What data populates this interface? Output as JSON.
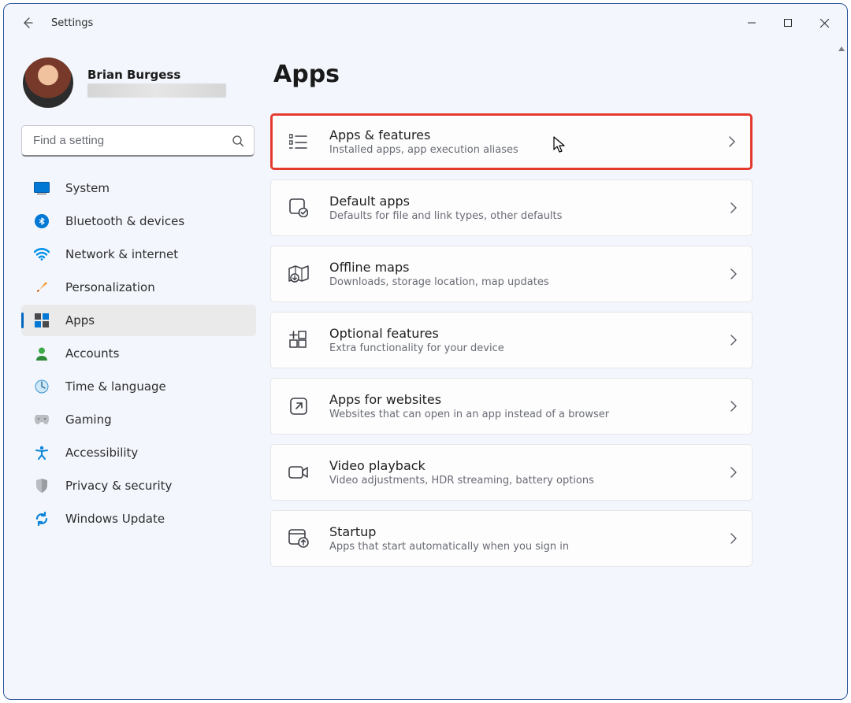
{
  "window": {
    "title": "Settings"
  },
  "profile": {
    "name": "Brian Burgess"
  },
  "search": {
    "placeholder": "Find a setting"
  },
  "nav": {
    "items": [
      {
        "id": "system",
        "label": "System"
      },
      {
        "id": "bluetooth",
        "label": "Bluetooth & devices"
      },
      {
        "id": "network",
        "label": "Network & internet"
      },
      {
        "id": "personalization",
        "label": "Personalization"
      },
      {
        "id": "apps",
        "label": "Apps"
      },
      {
        "id": "accounts",
        "label": "Accounts"
      },
      {
        "id": "time",
        "label": "Time & language"
      },
      {
        "id": "gaming",
        "label": "Gaming"
      },
      {
        "id": "accessibility",
        "label": "Accessibility"
      },
      {
        "id": "privacy",
        "label": "Privacy & security"
      },
      {
        "id": "update",
        "label": "Windows Update"
      }
    ]
  },
  "page": {
    "title": "Apps"
  },
  "cards": [
    {
      "id": "apps-features",
      "title": "Apps & features",
      "desc": "Installed apps, app execution aliases"
    },
    {
      "id": "default-apps",
      "title": "Default apps",
      "desc": "Defaults for file and link types, other defaults"
    },
    {
      "id": "offline-maps",
      "title": "Offline maps",
      "desc": "Downloads, storage location, map updates"
    },
    {
      "id": "optional-features",
      "title": "Optional features",
      "desc": "Extra functionality for your device"
    },
    {
      "id": "apps-websites",
      "title": "Apps for websites",
      "desc": "Websites that can open in an app instead of a browser"
    },
    {
      "id": "video-playback",
      "title": "Video playback",
      "desc": "Video adjustments, HDR streaming, battery options"
    },
    {
      "id": "startup",
      "title": "Startup",
      "desc": "Apps that start automatically when you sign in"
    }
  ]
}
